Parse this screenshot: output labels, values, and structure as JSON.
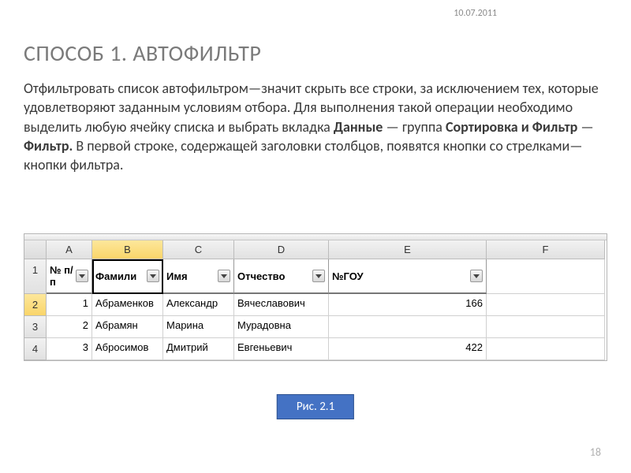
{
  "date": "10.07.2011",
  "title": "СПОСОБ 1. АВТОФИЛЬТР",
  "paragraph": {
    "p1": "Отфильтровать список автофильтром—значит скрыть все строки, за исключением тех, которые удовлетворяют заданным условиям отбора. Для выполнения такой операции необходимо выделить любую ячейку списка и выбрать вкладка ",
    "b1": "Данные",
    "p2": " — группа ",
    "b2": "Сортировка и Фильтр",
    "p3": " — ",
    "b3": "Фильтр.",
    "p4": " В первой строке, содержащей заголовки столбцов, появятся кнопки со стрелками—кнопки фильтра."
  },
  "chart_data": {
    "type": "table",
    "column_letters": [
      "A",
      "B",
      "C",
      "D",
      "E",
      "F"
    ],
    "row_numbers": [
      "1",
      "2",
      "3",
      "4"
    ],
    "selected_column": "B",
    "selected_row": "2",
    "headers": [
      "№ п/п",
      "Фамили",
      "Имя",
      "Отчество",
      "№ГОУ",
      ""
    ],
    "rows": [
      {
        "n": "1",
        "fam": "Абраменков",
        "imya": "Александр",
        "otch": "Вячеславович",
        "gou": "166"
      },
      {
        "n": "2",
        "fam": "Абрамян",
        "imya": "Марина",
        "otch": "Мурадовна",
        "gou": ""
      },
      {
        "n": "3",
        "fam": "Абросимов",
        "imya": "Дмитрий",
        "otch": "Евгеньевич",
        "gou": "422"
      }
    ]
  },
  "caption": "Рис. 2.1",
  "page_number": "18"
}
